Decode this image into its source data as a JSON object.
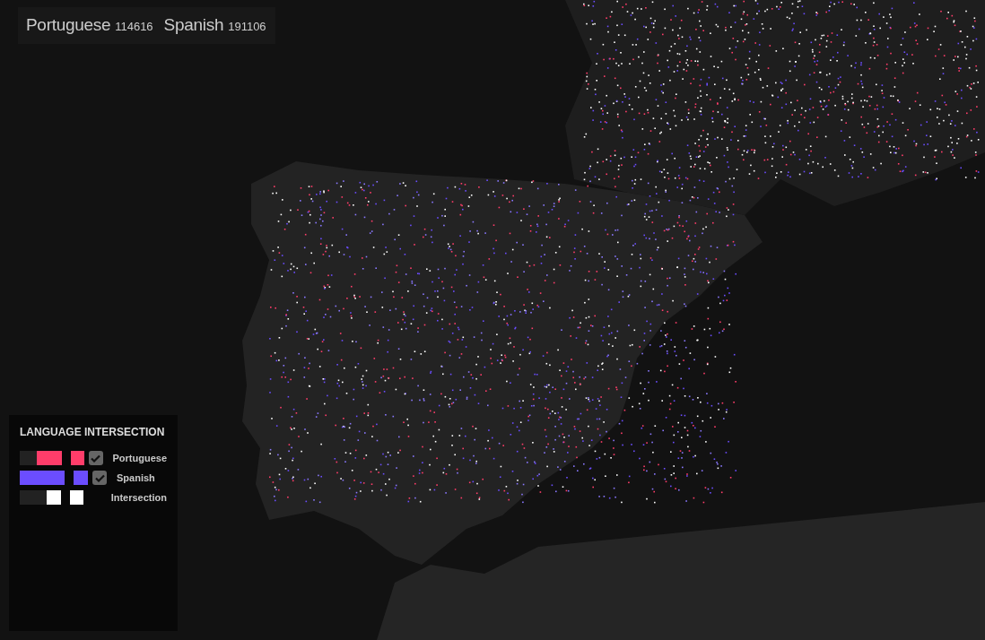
{
  "counts": [
    {
      "language": "Portuguese",
      "count": "114616"
    },
    {
      "language": "Spanish",
      "count": "191106"
    }
  ],
  "legend": {
    "title": "LANGUAGE INTERSECTION",
    "items": [
      {
        "kind": "language",
        "label": "Portuguese",
        "color": "#ff3d6a",
        "level": 0.6,
        "checked": true
      },
      {
        "kind": "language",
        "label": "Spanish",
        "color": "#6b4dff",
        "level": 1,
        "checked": true
      },
      {
        "kind": "intersection",
        "label": "Intersection",
        "color": "#ffffff",
        "level": 0.35
      }
    ]
  }
}
